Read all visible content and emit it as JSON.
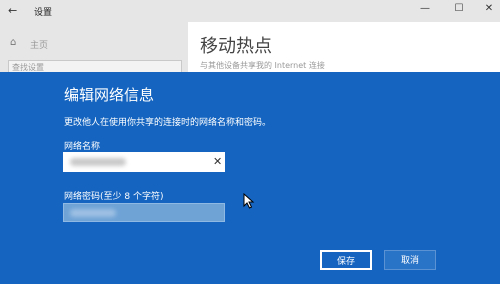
{
  "window": {
    "title": "设置",
    "back_icon": "←",
    "minimize": "—",
    "maximize": "☐",
    "close": "✕"
  },
  "sidebar": {
    "home_icon": "⌂",
    "home_label": "主页",
    "search_placeholder": "查找设置"
  },
  "main": {
    "title": "移动热点",
    "subtitle": "与其他设备共享我的 Internet 连接"
  },
  "dialog": {
    "title": "编辑网络信息",
    "description": "更改他人在使用你共享的连接时的网络名称和密码。",
    "name_label": "网络名称",
    "password_label": "网络密码(至少 8 个字符)",
    "clear_icon": "✕",
    "save_label": "保存",
    "cancel_label": "取消",
    "colors": {
      "background": "#1565c0",
      "save_border": "#ffffff"
    }
  }
}
